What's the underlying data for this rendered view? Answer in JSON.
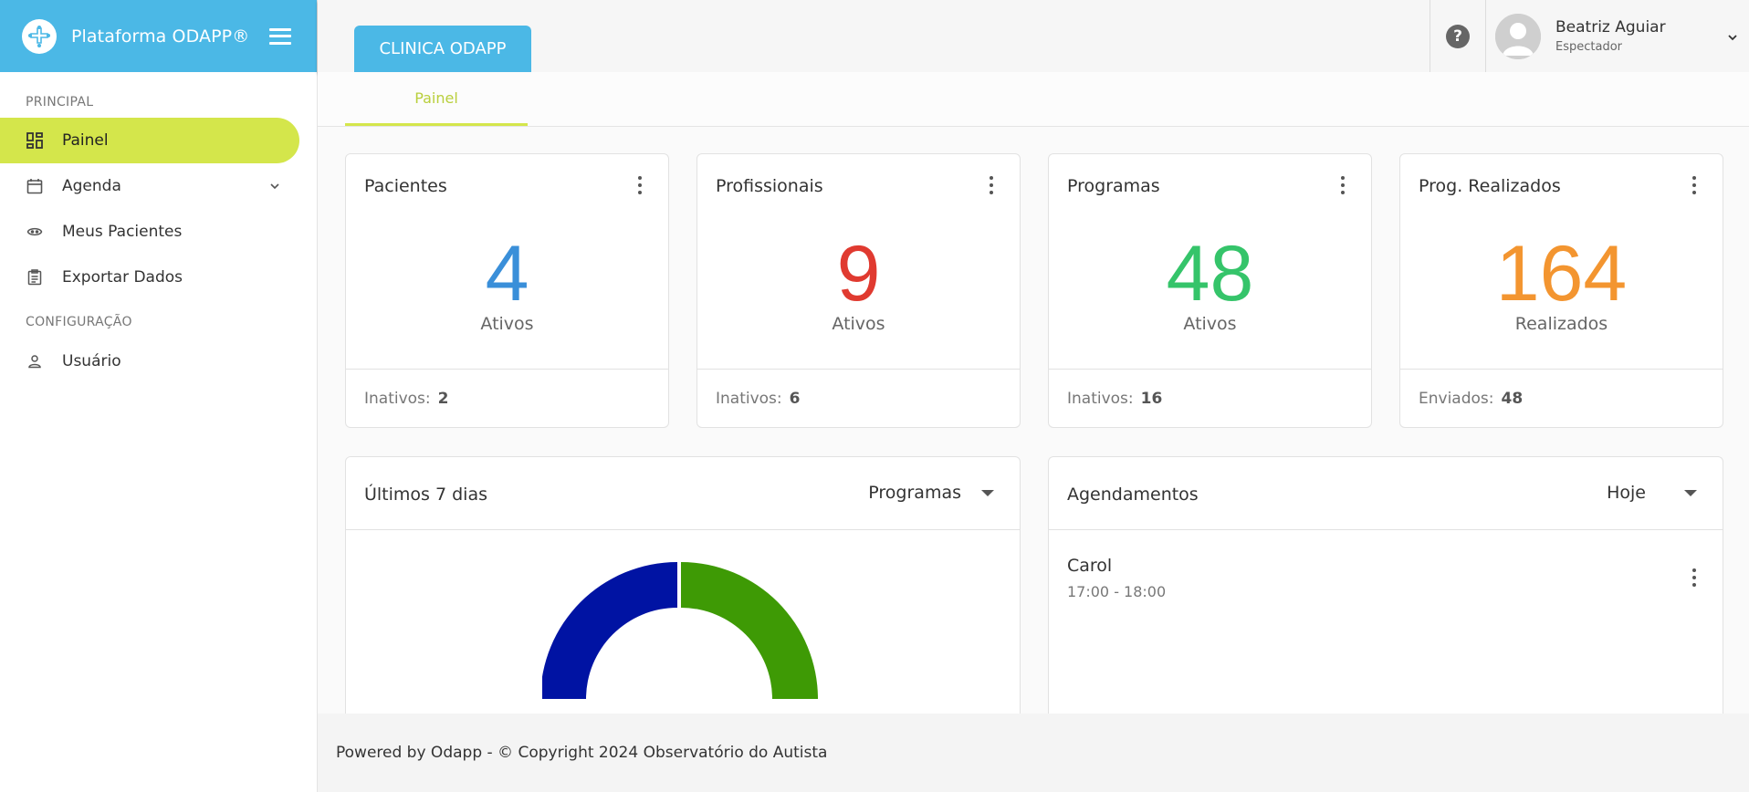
{
  "app": {
    "brand": "Plataforma ODAPP®"
  },
  "sidebar": {
    "section_principal": "PRINCIPAL",
    "section_config": "CONFIGURAÇÃO",
    "items": [
      {
        "label": "Painel",
        "icon": "dashboard-icon",
        "active": true
      },
      {
        "label": "Agenda",
        "icon": "calendar-icon"
      },
      {
        "label": "Meus Pacientes",
        "icon": "face-icon"
      },
      {
        "label": "Exportar Dados",
        "icon": "clipboard-icon"
      },
      {
        "label": "Usuário",
        "icon": "person-icon"
      }
    ]
  },
  "header": {
    "clinic_tab": "CLINICA ODAPP",
    "user": {
      "name": "Beatriz Aguiar",
      "role": "Espectador"
    }
  },
  "subtabs": {
    "active": "Painel"
  },
  "stats": [
    {
      "title": "Pacientes",
      "value": "4",
      "label": "Ativos",
      "footer_label": "Inativos:",
      "footer_value": "2",
      "color": "#3a8fd9"
    },
    {
      "title": "Profissionais",
      "value": "9",
      "label": "Ativos",
      "footer_label": "Inativos:",
      "footer_value": "6",
      "color": "#e03a30"
    },
    {
      "title": "Programas",
      "value": "48",
      "label": "Ativos",
      "footer_label": "Inativos:",
      "footer_value": "16",
      "color": "#35c46a"
    },
    {
      "title": "Prog. Realizados",
      "value": "164",
      "label": "Realizados",
      "footer_label": "Enviados:",
      "footer_value": "48",
      "color": "#f39530"
    }
  ],
  "chart_panel": {
    "title": "Últimos 7 dias",
    "select": "Programas",
    "colors": [
      "#3e9a05",
      "#0013a3"
    ]
  },
  "appointments": {
    "title": "Agendamentos",
    "select": "Hoje",
    "items": [
      {
        "name": "Carol",
        "time": "17:00 - 18:00"
      }
    ]
  },
  "footer": {
    "text": "Powered by Odapp - © Copyright 2024 Observatório do Autista"
  }
}
